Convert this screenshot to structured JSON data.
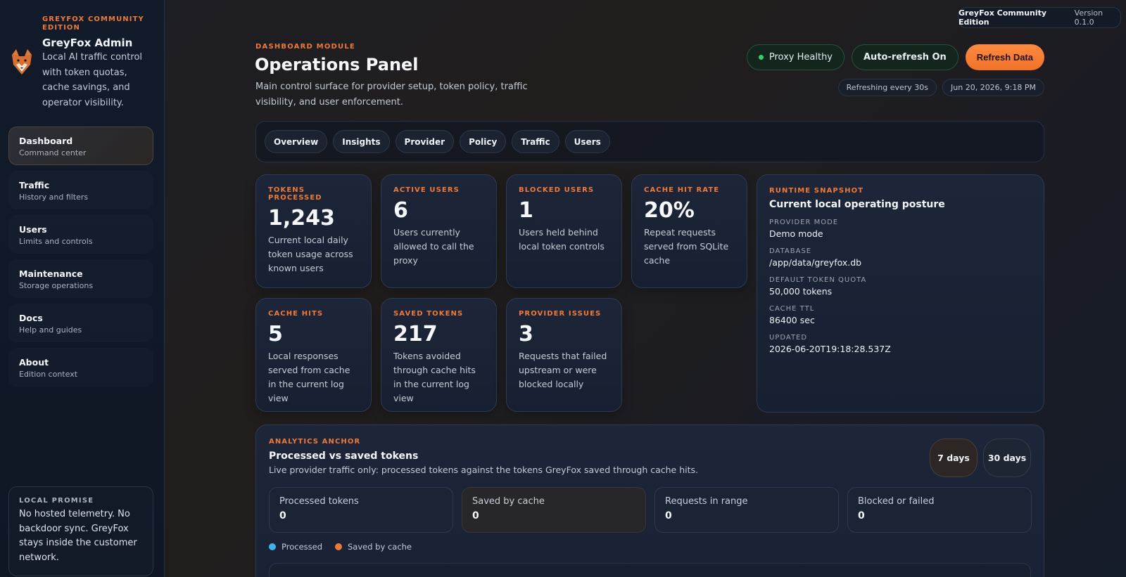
{
  "version": {
    "edition": "GreyFox Community Edition",
    "number": "Version 0.1.0"
  },
  "brand": {
    "edition": "GREYFOX COMMUNITY EDITION",
    "title": "GreyFox Admin",
    "description": "Local AI traffic control with token quotas, cache savings, and operator visibility."
  },
  "nav": [
    {
      "label": "Dashboard",
      "sub": "Command center"
    },
    {
      "label": "Traffic",
      "sub": "History and filters"
    },
    {
      "label": "Users",
      "sub": "Limits and controls"
    },
    {
      "label": "Maintenance",
      "sub": "Storage operations"
    },
    {
      "label": "Docs",
      "sub": "Help and guides"
    },
    {
      "label": "About",
      "sub": "Edition context"
    }
  ],
  "promise": {
    "title": "LOCAL PROMISE",
    "text": "No hosted telemetry. No backdoor sync. GreyFox stays inside the customer network."
  },
  "header": {
    "module": "DASHBOARD MODULE",
    "title": "Operations Panel",
    "description": "Main control surface for provider setup, token policy, traffic visibility, and user enforcement.",
    "status": "Proxy Healthy",
    "auto_refresh": "Auto-refresh On",
    "refresh": "Refresh Data",
    "interval": "Refreshing every 30s",
    "timestamp": "Jun 20, 2026, 9:18 PM"
  },
  "tabs": [
    "Overview",
    "Insights",
    "Provider",
    "Policy",
    "Traffic",
    "Users"
  ],
  "stats": [
    {
      "label": "TOKENS PROCESSED",
      "value": "1,243",
      "desc": "Current local daily token usage across known users"
    },
    {
      "label": "ACTIVE USERS",
      "value": "6",
      "desc": "Users currently allowed to call the proxy"
    },
    {
      "label": "BLOCKED USERS",
      "value": "1",
      "desc": "Users held behind local token controls"
    },
    {
      "label": "CACHE HIT RATE",
      "value": "20%",
      "desc": "Repeat requests served from SQLite cache"
    },
    {
      "label": "CACHE HITS",
      "value": "5",
      "desc": "Local responses served from cache in the current log view"
    },
    {
      "label": "SAVED TOKENS",
      "value": "217",
      "desc": "Tokens avoided through cache hits in the current log view"
    },
    {
      "label": "PROVIDER ISSUES",
      "value": "3",
      "desc": "Requests that failed upstream or were blocked locally"
    }
  ],
  "snapshot": {
    "label": "RUNTIME SNAPSHOT",
    "title": "Current local operating posture",
    "rows": [
      {
        "key": "PROVIDER MODE",
        "value": "Demo mode"
      },
      {
        "key": "DATABASE",
        "value": "/app/data/greyfox.db"
      },
      {
        "key": "DEFAULT TOKEN QUOTA",
        "value": "50,000 tokens"
      },
      {
        "key": "CACHE TTL",
        "value": "86400 sec"
      },
      {
        "key": "UPDATED",
        "value": "2026-06-20T19:18:28.537Z"
      }
    ]
  },
  "analytics": {
    "label": "ANALYTICS ANCHOR",
    "title": "Processed vs saved tokens",
    "description": "Live provider traffic only: processed tokens against the tokens GreyFox saved through cache hits.",
    "ranges": [
      "7 days",
      "30 days"
    ],
    "metrics": [
      {
        "label": "Processed tokens",
        "value": "0"
      },
      {
        "label": "Saved by cache",
        "value": "0"
      },
      {
        "label": "Requests in range",
        "value": "0"
      },
      {
        "label": "Blocked or failed",
        "value": "0"
      }
    ],
    "legend": [
      {
        "name": "Processed",
        "color": "#3bb4ec"
      },
      {
        "name": "Saved by cache",
        "color": "#f07a35"
      }
    ]
  },
  "colors": {
    "accent": "#f07a35",
    "healthy": "#2bd46b",
    "processed": "#3bb4ec"
  }
}
